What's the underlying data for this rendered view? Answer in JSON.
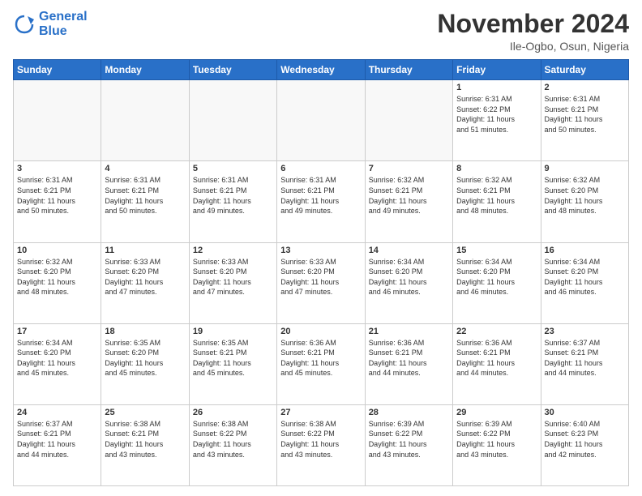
{
  "header": {
    "logo_line1": "General",
    "logo_line2": "Blue",
    "month": "November 2024",
    "location": "Ile-Ogbo, Osun, Nigeria"
  },
  "days_of_week": [
    "Sunday",
    "Monday",
    "Tuesday",
    "Wednesday",
    "Thursday",
    "Friday",
    "Saturday"
  ],
  "weeks": [
    [
      {
        "day": "",
        "empty": true,
        "info": ""
      },
      {
        "day": "",
        "empty": true,
        "info": ""
      },
      {
        "day": "",
        "empty": true,
        "info": ""
      },
      {
        "day": "",
        "empty": true,
        "info": ""
      },
      {
        "day": "",
        "empty": true,
        "info": ""
      },
      {
        "day": "1",
        "info": "Sunrise: 6:31 AM\nSunset: 6:22 PM\nDaylight: 11 hours\nand 51 minutes."
      },
      {
        "day": "2",
        "info": "Sunrise: 6:31 AM\nSunset: 6:21 PM\nDaylight: 11 hours\nand 50 minutes."
      }
    ],
    [
      {
        "day": "3",
        "info": "Sunrise: 6:31 AM\nSunset: 6:21 PM\nDaylight: 11 hours\nand 50 minutes."
      },
      {
        "day": "4",
        "info": "Sunrise: 6:31 AM\nSunset: 6:21 PM\nDaylight: 11 hours\nand 50 minutes."
      },
      {
        "day": "5",
        "info": "Sunrise: 6:31 AM\nSunset: 6:21 PM\nDaylight: 11 hours\nand 49 minutes."
      },
      {
        "day": "6",
        "info": "Sunrise: 6:31 AM\nSunset: 6:21 PM\nDaylight: 11 hours\nand 49 minutes."
      },
      {
        "day": "7",
        "info": "Sunrise: 6:32 AM\nSunset: 6:21 PM\nDaylight: 11 hours\nand 49 minutes."
      },
      {
        "day": "8",
        "info": "Sunrise: 6:32 AM\nSunset: 6:21 PM\nDaylight: 11 hours\nand 48 minutes."
      },
      {
        "day": "9",
        "info": "Sunrise: 6:32 AM\nSunset: 6:20 PM\nDaylight: 11 hours\nand 48 minutes."
      }
    ],
    [
      {
        "day": "10",
        "info": "Sunrise: 6:32 AM\nSunset: 6:20 PM\nDaylight: 11 hours\nand 48 minutes."
      },
      {
        "day": "11",
        "info": "Sunrise: 6:33 AM\nSunset: 6:20 PM\nDaylight: 11 hours\nand 47 minutes."
      },
      {
        "day": "12",
        "info": "Sunrise: 6:33 AM\nSunset: 6:20 PM\nDaylight: 11 hours\nand 47 minutes."
      },
      {
        "day": "13",
        "info": "Sunrise: 6:33 AM\nSunset: 6:20 PM\nDaylight: 11 hours\nand 47 minutes."
      },
      {
        "day": "14",
        "info": "Sunrise: 6:34 AM\nSunset: 6:20 PM\nDaylight: 11 hours\nand 46 minutes."
      },
      {
        "day": "15",
        "info": "Sunrise: 6:34 AM\nSunset: 6:20 PM\nDaylight: 11 hours\nand 46 minutes."
      },
      {
        "day": "16",
        "info": "Sunrise: 6:34 AM\nSunset: 6:20 PM\nDaylight: 11 hours\nand 46 minutes."
      }
    ],
    [
      {
        "day": "17",
        "info": "Sunrise: 6:34 AM\nSunset: 6:20 PM\nDaylight: 11 hours\nand 45 minutes."
      },
      {
        "day": "18",
        "info": "Sunrise: 6:35 AM\nSunset: 6:20 PM\nDaylight: 11 hours\nand 45 minutes."
      },
      {
        "day": "19",
        "info": "Sunrise: 6:35 AM\nSunset: 6:21 PM\nDaylight: 11 hours\nand 45 minutes."
      },
      {
        "day": "20",
        "info": "Sunrise: 6:36 AM\nSunset: 6:21 PM\nDaylight: 11 hours\nand 45 minutes."
      },
      {
        "day": "21",
        "info": "Sunrise: 6:36 AM\nSunset: 6:21 PM\nDaylight: 11 hours\nand 44 minutes."
      },
      {
        "day": "22",
        "info": "Sunrise: 6:36 AM\nSunset: 6:21 PM\nDaylight: 11 hours\nand 44 minutes."
      },
      {
        "day": "23",
        "info": "Sunrise: 6:37 AM\nSunset: 6:21 PM\nDaylight: 11 hours\nand 44 minutes."
      }
    ],
    [
      {
        "day": "24",
        "info": "Sunrise: 6:37 AM\nSunset: 6:21 PM\nDaylight: 11 hours\nand 44 minutes."
      },
      {
        "day": "25",
        "info": "Sunrise: 6:38 AM\nSunset: 6:21 PM\nDaylight: 11 hours\nand 43 minutes."
      },
      {
        "day": "26",
        "info": "Sunrise: 6:38 AM\nSunset: 6:22 PM\nDaylight: 11 hours\nand 43 minutes."
      },
      {
        "day": "27",
        "info": "Sunrise: 6:38 AM\nSunset: 6:22 PM\nDaylight: 11 hours\nand 43 minutes."
      },
      {
        "day": "28",
        "info": "Sunrise: 6:39 AM\nSunset: 6:22 PM\nDaylight: 11 hours\nand 43 minutes."
      },
      {
        "day": "29",
        "info": "Sunrise: 6:39 AM\nSunset: 6:22 PM\nDaylight: 11 hours\nand 43 minutes."
      },
      {
        "day": "30",
        "info": "Sunrise: 6:40 AM\nSunset: 6:23 PM\nDaylight: 11 hours\nand 42 minutes."
      }
    ]
  ]
}
